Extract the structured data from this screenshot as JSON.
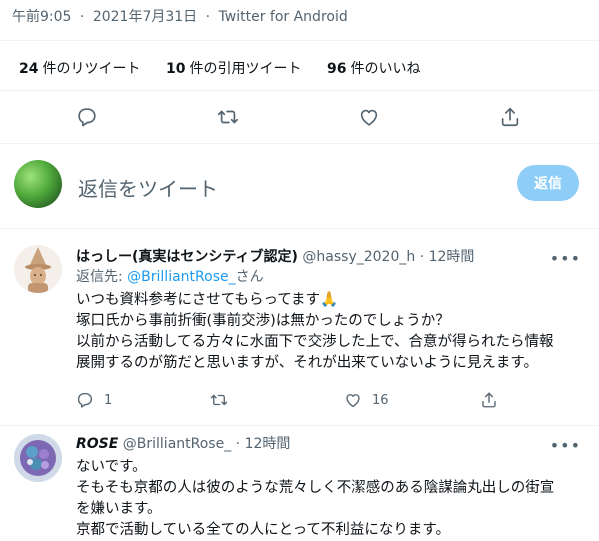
{
  "meta": {
    "time": "午前9:05",
    "sep": "·",
    "date": "2021年7月31日",
    "client": "Twitter for Android"
  },
  "stats": {
    "retweets": {
      "count": "24",
      "label": "件のリツイート"
    },
    "quotes": {
      "count": "10",
      "label": "件の引用ツイート"
    },
    "likes": {
      "count": "96",
      "label": "件のいいね"
    }
  },
  "compose": {
    "placeholder": "返信をツイート",
    "button": "返信"
  },
  "replies": [
    {
      "name": "はっしー(真実はセンシティブ認定)",
      "handle": "@hassy_2020_h",
      "sep": "·",
      "time": "12時間",
      "reply_prefix": "返信先: ",
      "reply_to": "@BrilliantRose_",
      "reply_suffix": "さん",
      "lines": [
        "いつも資料参考にさせてもらってます🙏",
        "塚口氏から事前折衝(事前交渉)は無かったのでしょうか？",
        "以前から活動してる方々に水面下で交渉した上で、合意が得られたら情報",
        "展開するのが筋だと思いますが、それが出来ていないように見えます。"
      ],
      "reply_count": "1",
      "retweet_count": "",
      "like_count": "16"
    },
    {
      "name": "ROSE",
      "handle": "@BrilliantRose_",
      "sep": "·",
      "time": "12時間",
      "lines": [
        "ないです。",
        "そもそも京都の人は彼のような荒々しく不潔感のある陰謀論丸出しの街宣",
        "を嫌います。",
        "京都で活動している全ての人にとって不利益になります。"
      ]
    }
  ],
  "colors": {
    "accent": "#1d9bf0",
    "muted": "#536471",
    "reply_button": "#8ecdf8",
    "divider": "#eff3f4"
  },
  "icons": [
    "reply-icon",
    "retweet-icon",
    "like-icon",
    "share-icon",
    "more-icon"
  ]
}
